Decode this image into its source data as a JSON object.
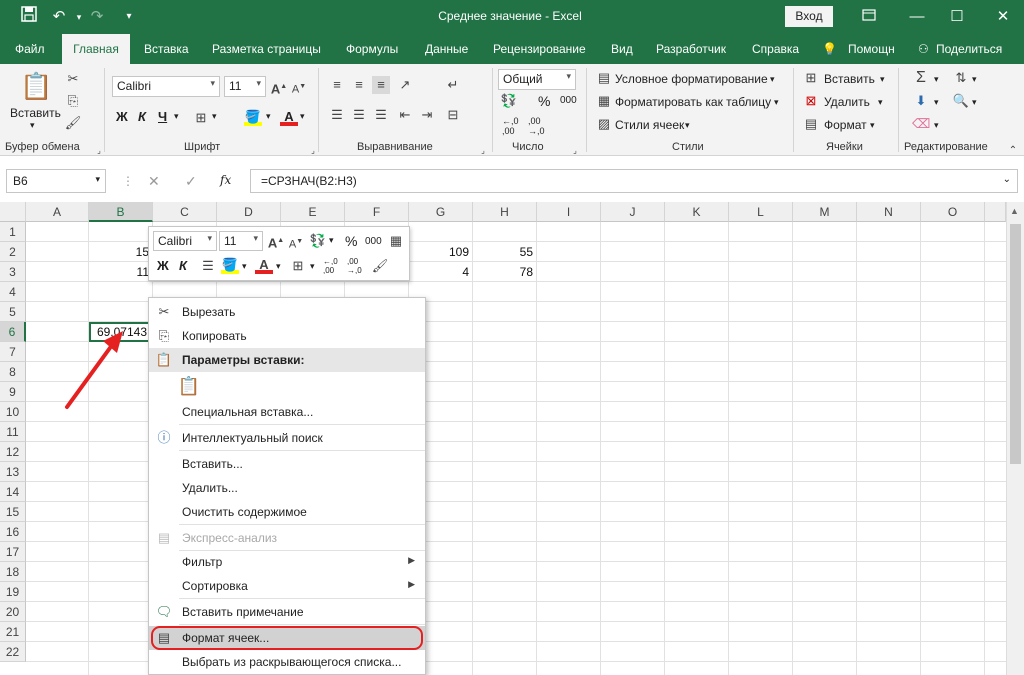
{
  "window": {
    "title": "Среднее значение  -  Excel",
    "login_label": "Вход",
    "colors": {
      "brand": "#217346",
      "highlight_outline": "#e52020",
      "arrow": "#e52020"
    }
  },
  "qat": {
    "icons": [
      "save-icon",
      "undo-icon",
      "redo-icon",
      "customize-icon"
    ]
  },
  "ribbon_tabs": [
    "Файл",
    "Главная",
    "Вставка",
    "Разметка страницы",
    "Формулы",
    "Данные",
    "Рецензирование",
    "Вид",
    "Разработчик",
    "Справка"
  ],
  "tell_me": "Помощн",
  "share": "Поделиться",
  "ribbon": {
    "clipboard": {
      "paste": "Вставить",
      "label": "Буфер обмена"
    },
    "font": {
      "name": "Calibri",
      "size": "11",
      "bold": "Ж",
      "italic": "К",
      "underline": "Ч",
      "label": "Шрифт"
    },
    "alignment": {
      "label": "Выравнивание"
    },
    "number": {
      "format": "Общий",
      "label": "Число"
    },
    "styles": {
      "conditional": "Условное форматирование",
      "as_table": "Форматировать как таблицу",
      "cell_styles": "Стили ячеек",
      "label": "Стили"
    },
    "cells": {
      "insert": "Вставить",
      "delete": "Удалить",
      "format": "Формат",
      "label": "Ячейки"
    },
    "editing": {
      "label": "Редактирование"
    }
  },
  "formula_bar": {
    "name_box": "B6",
    "fx": "fx",
    "formula": "=СРЗНАЧ(B2:H3)"
  },
  "columns": [
    "A",
    "B",
    "C",
    "D",
    "E",
    "F",
    "G",
    "H",
    "I",
    "J",
    "K",
    "L",
    "M",
    "N",
    "O"
  ],
  "rows": [
    "1",
    "2",
    "3",
    "4",
    "5",
    "6",
    "7",
    "8",
    "9",
    "10",
    "11",
    "12",
    "13",
    "14",
    "15",
    "16",
    "17",
    "18",
    "19",
    "20",
    "21",
    "22"
  ],
  "cells": {
    "B2": "15",
    "B3": "11",
    "G2": "109",
    "H2": "55",
    "G3": "4",
    "H3": "78",
    "B6": "69,07143"
  },
  "mini_toolbar": {
    "font": "Calibri",
    "size": "11",
    "bold": "Ж",
    "italic": "К",
    "percent": "%",
    "thousands": "000"
  },
  "context_menu": {
    "cut": "Вырезать",
    "copy": "Копировать",
    "paste_options": "Параметры вставки:",
    "paste_special": "Специальная вставка...",
    "smart_lookup": "Интеллектуальный поиск",
    "insert": "Вставить...",
    "delete": "Удалить...",
    "clear": "Очистить содержимое",
    "quick_analysis": "Экспресс-анализ",
    "filter": "Фильтр",
    "sort": "Сортировка",
    "insert_comment": "Вставить примечание",
    "format_cells": "Формат ячеек...",
    "pick_from_list": "Выбрать из раскрывающегося списка..."
  }
}
